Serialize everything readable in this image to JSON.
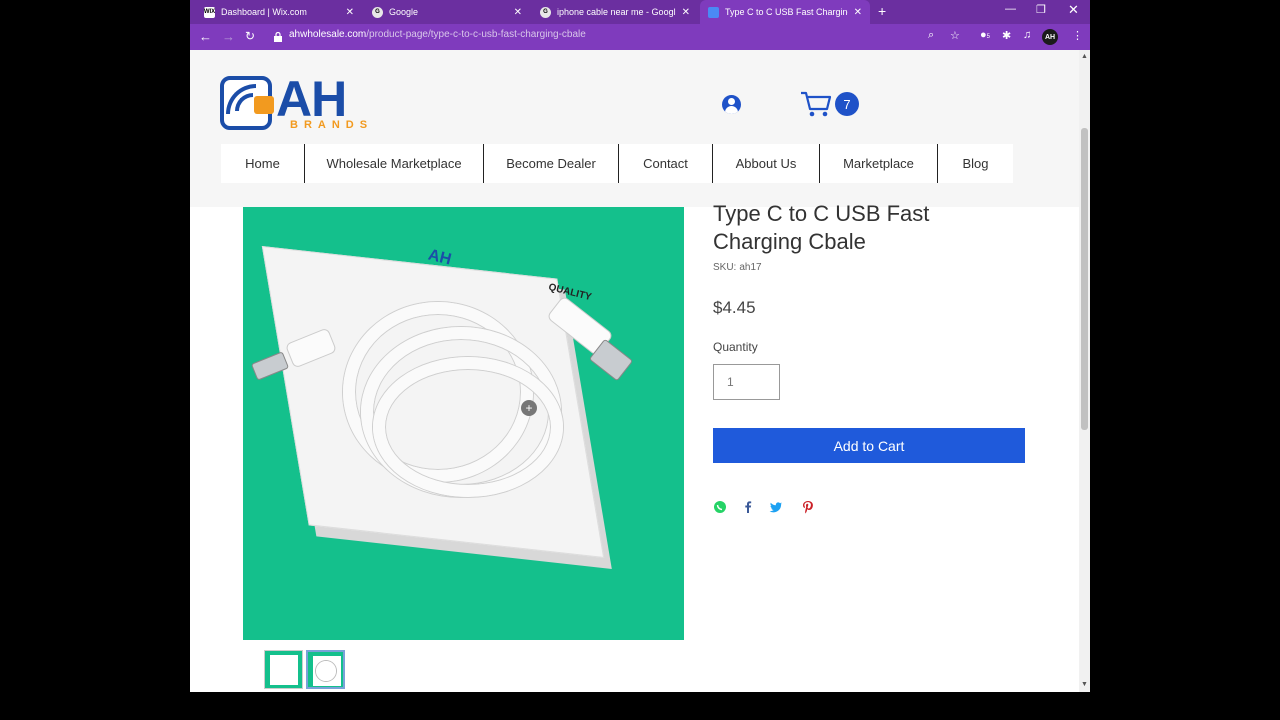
{
  "browser": {
    "tabs": [
      {
        "title": "Dashboard | Wix.com",
        "favicon": "wix-icon",
        "active": false
      },
      {
        "title": "Google",
        "favicon": "google-icon",
        "active": false
      },
      {
        "title": "iphone cable near me - Google S",
        "favicon": "google-icon",
        "active": false
      },
      {
        "title": "Type C to C USB Fast Charging C",
        "favicon": "site-icon",
        "active": true
      }
    ],
    "url_host": "ahwholesale.com",
    "url_path": "/product-page/type-c-to-c-usb-fast-charging-cbale",
    "profile_initials": "AH",
    "extension_badge": "5"
  },
  "site": {
    "logo_text": "AH",
    "logo_sub": "BRANDS",
    "cart_count": "7",
    "menu": [
      "Home",
      "Wholesale Marketplace",
      "Become Dealer",
      "Contact",
      "Abbout Us",
      "Marketplace",
      "Blog"
    ],
    "colors": {
      "brand_blue": "#1b4da8",
      "brand_orange": "#f29a1f",
      "button_blue": "#1f5adb",
      "browser_purple": "#7f3bbd"
    }
  },
  "product": {
    "title": "Type C to C USB Fast Charging Cbale",
    "sku_label": "SKU:",
    "sku": "ah17",
    "price": "$4.45",
    "quantity_label": "Quantity",
    "quantity_value": "1",
    "add_to_cart": "Add to Cart",
    "image_box_logo": "AH",
    "image_box_text": "QUALITY",
    "share": [
      "whatsapp-icon",
      "facebook-icon",
      "twitter-icon",
      "pinterest-icon"
    ]
  }
}
